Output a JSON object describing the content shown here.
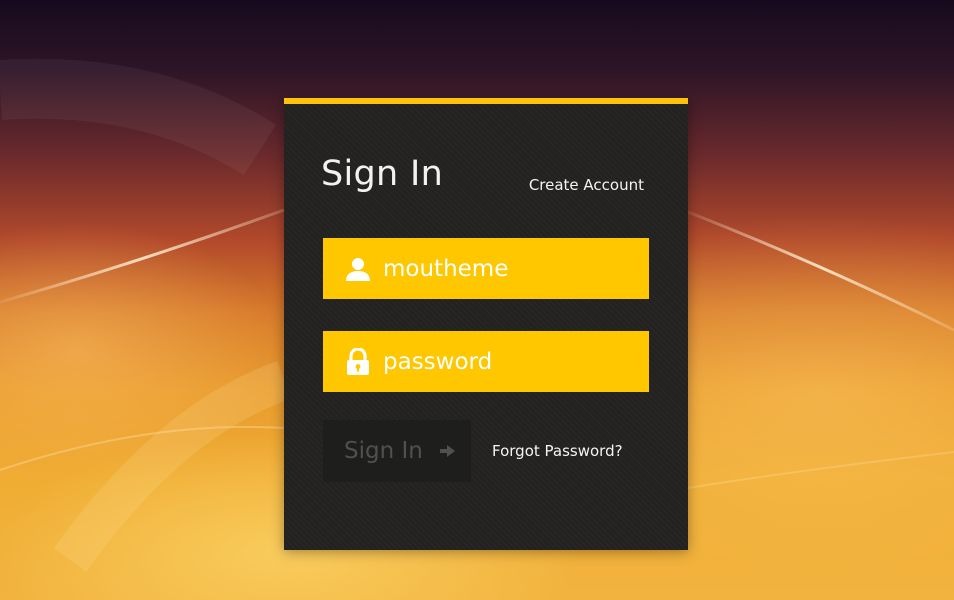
{
  "login": {
    "title": "Sign In",
    "create_account_label": "Create Account",
    "username": {
      "value": "moutheme",
      "icon": "user-icon"
    },
    "password": {
      "placeholder": "password",
      "icon": "lock-icon"
    },
    "signin_button_label": "Sign In",
    "signin_button_icon": "arrow-right-icon",
    "forgot_password_label": "Forgot Password?"
  },
  "colors": {
    "accent": "#fec10c",
    "field_background": "#fec700",
    "card_background": "#232220",
    "button_background": "#1e1e1d",
    "button_text": "#505050"
  }
}
